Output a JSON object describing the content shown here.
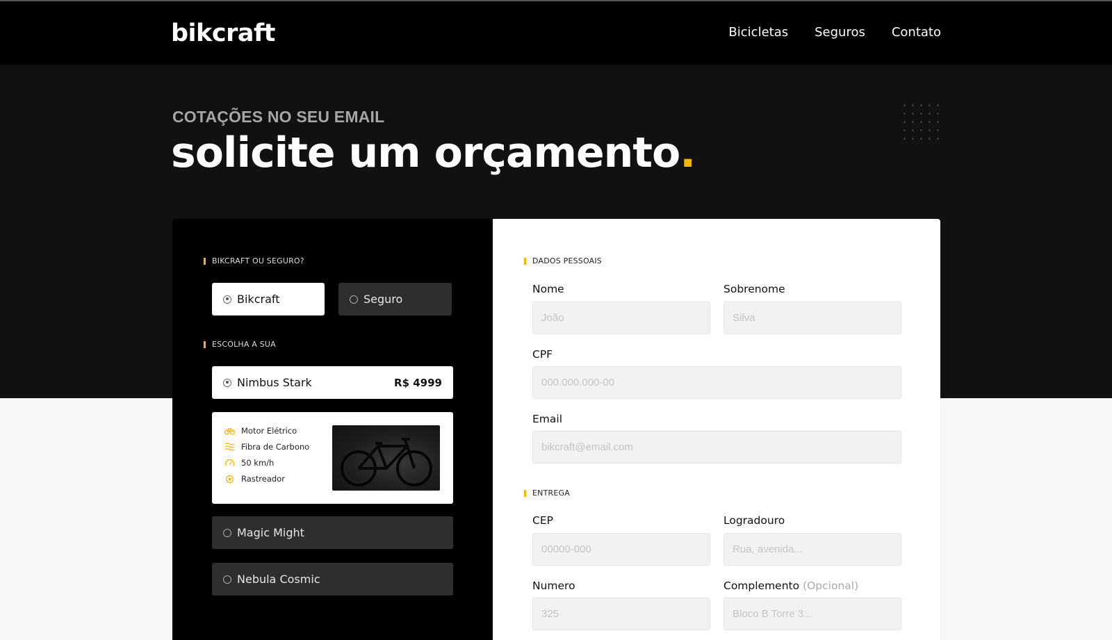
{
  "header": {
    "logo": "bikcraft",
    "nav": [
      "Bicicletas",
      "Seguros",
      "Contato"
    ]
  },
  "hero": {
    "eyebrow": "COTAÇÕES NO SEU EMAIL",
    "title": "solicite um orçamento",
    "title_dot": "."
  },
  "left": {
    "choice_label": "BIKCRAFT OU SEGURO?",
    "choice_options": [
      "Bikcraft",
      "Seguro"
    ],
    "choice_selected": "Bikcraft",
    "bike_label": "ESCOLHA A SUA",
    "bikes": [
      {
        "name": "Nimbus Stark",
        "price": "R$ 4999",
        "selected": true
      },
      {
        "name": "Magic Might",
        "selected": false
      },
      {
        "name": "Nebula Cosmic",
        "selected": false
      }
    ],
    "features": [
      {
        "icon": "electric-motor-icon",
        "text": "Motor Elétrico"
      },
      {
        "icon": "carbon-fiber-icon",
        "text": "Fibra de Carbono"
      },
      {
        "icon": "speedometer-icon",
        "text": "50 km/h"
      },
      {
        "icon": "tracker-icon",
        "text": "Rastreador"
      }
    ]
  },
  "form": {
    "personal_label": "DADOS PESSOAIS",
    "nome": {
      "label": "Nome",
      "placeholder": "João"
    },
    "sobrenome": {
      "label": "Sobrenome",
      "placeholder": "Silva"
    },
    "cpf": {
      "label": "CPF",
      "placeholder": "000.000.000-00"
    },
    "email": {
      "label": "Email",
      "placeholder": "bikcraft@email.com"
    },
    "delivery_label": "ENTREGA",
    "cep": {
      "label": "CEP",
      "placeholder": "00000-000"
    },
    "logradouro": {
      "label": "Logradouro",
      "placeholder": "Rua, avenida..."
    },
    "numero": {
      "label": "Numero",
      "placeholder": "325"
    },
    "complemento": {
      "label": "Complemento",
      "hint": "(Opcional)",
      "placeholder": "Bloco B Torre 3..."
    }
  },
  "colors": {
    "accent": "#f5b800",
    "dark": "#000000",
    "hero": "#111111"
  }
}
